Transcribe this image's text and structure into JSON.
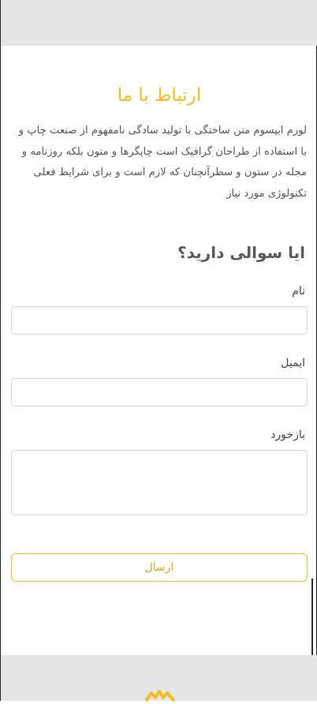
{
  "contact": {
    "title": "ارتباط با ما",
    "description": "لورم ایپسوم متن ساختگی با تولید سادگی نامفهوم از صنعت چاپ و با استفاده از طراحان گرافیک است چاپگرها و متون بلکه روزنامه و مجله در ستون و سطرآنچنان که لازم است و برای شرایط فعلی تکنولوژی مورد نیاز"
  },
  "form": {
    "heading": "ایا سوالی دارید؟",
    "name_label": "نام",
    "email_label": "ایمیل",
    "feedback_label": "بازخورد",
    "submit_label": "ارسال"
  },
  "colors": {
    "accent": "#f4bd1e",
    "header_footer_bg": "#e6e6e6"
  },
  "footer": {
    "logo_icon": "brand-logo-icon"
  }
}
